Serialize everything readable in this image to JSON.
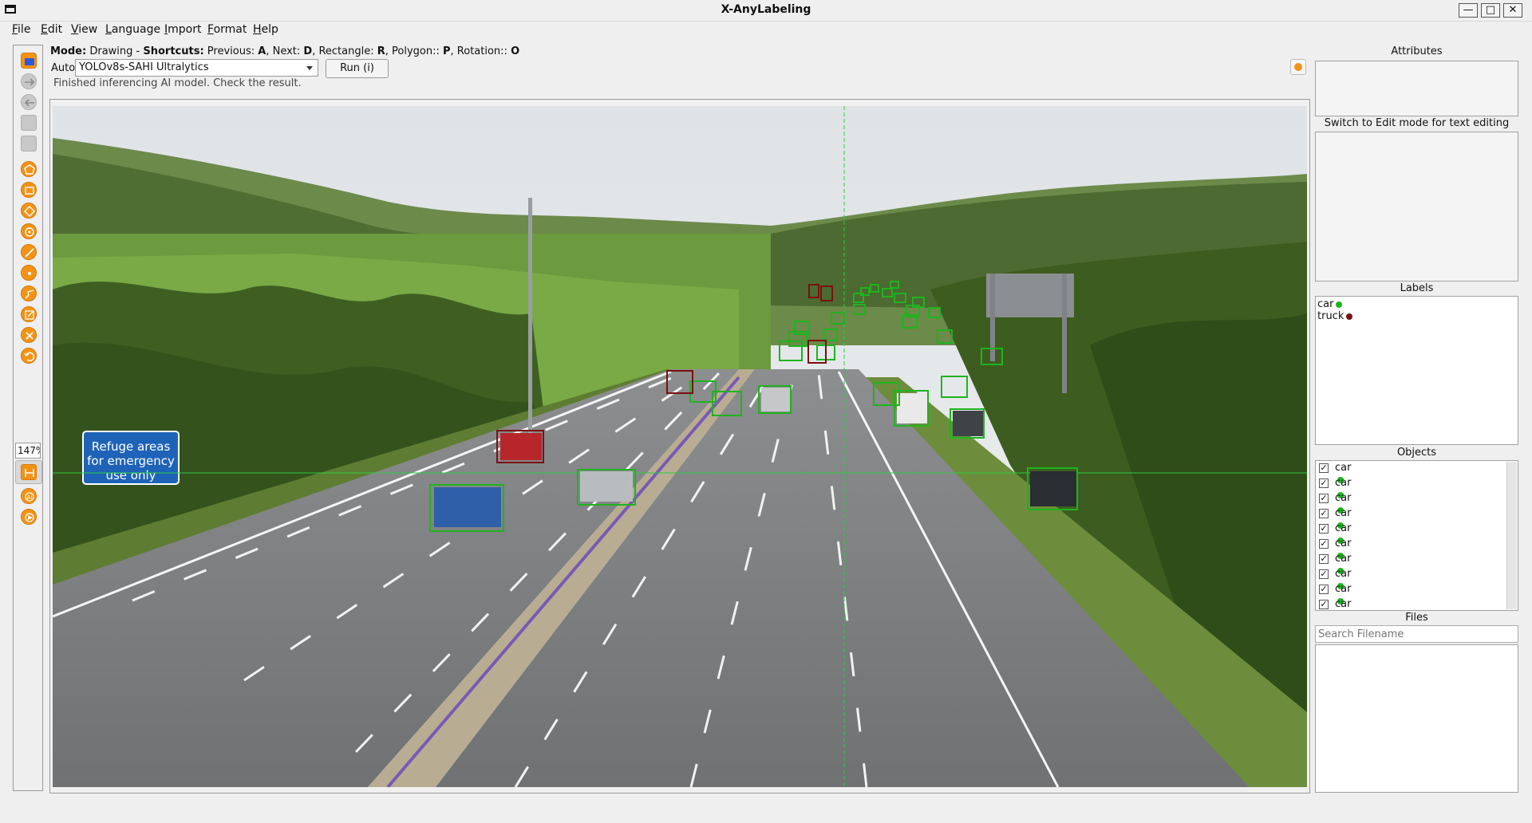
{
  "window": {
    "title": "X-AnyLabeling"
  },
  "menu": [
    "File",
    "Edit",
    "View",
    "Language",
    "Import",
    "Format",
    "Help"
  ],
  "mode_bar": {
    "mode_label": "Mode:",
    "mode_value": "Drawing",
    "sep": " - ",
    "shortcuts_label": "Shortcuts:",
    "previous": " Previous: ",
    "previous_key": "A",
    "next": ", Next: ",
    "next_key": "D",
    "rectangle": ", Rectangle: ",
    "rectangle_key": "R",
    "polygon": ", Polygon:: ",
    "polygon_key": "P",
    "rotation": ", Rotation:: ",
    "rotation_key": "O"
  },
  "auto": {
    "label": "Auto",
    "model": "YOLOv8s-SAHI Ultralytics",
    "run_button": "Run (i)",
    "status": "Finished inferencing AI model. Check the result."
  },
  "toolbar": {
    "zoom": "147%"
  },
  "canvas": {
    "sign_text": [
      "Refuge areas",
      "for emergency",
      "use only"
    ]
  },
  "right_panel": {
    "attributes_title": "Attributes",
    "attributes_hint": "Switch to Edit mode for text editing",
    "labels_title": "Labels",
    "labels": [
      {
        "name": "car",
        "color": "#1fb31f"
      },
      {
        "name": "truck",
        "color": "#7a1010"
      }
    ],
    "objects_title": "Objects",
    "objects": [
      {
        "label": "car",
        "checked": true,
        "color": "#1fb31f"
      },
      {
        "label": "car",
        "checked": true,
        "color": "#1fb31f"
      },
      {
        "label": "car",
        "checked": true,
        "color": "#1fb31f"
      },
      {
        "label": "car",
        "checked": true,
        "color": "#1fb31f"
      },
      {
        "label": "car",
        "checked": true,
        "color": "#1fb31f"
      },
      {
        "label": "car",
        "checked": true,
        "color": "#1fb31f"
      },
      {
        "label": "car",
        "checked": true,
        "color": "#1fb31f"
      },
      {
        "label": "car",
        "checked": true,
        "color": "#1fb31f"
      },
      {
        "label": "car",
        "checked": true,
        "color": "#1fb31f"
      },
      {
        "label": "car",
        "checked": true,
        "color": "#1fb31f"
      }
    ],
    "files_title": "Files",
    "search_placeholder": "Search Filename"
  },
  "colors": {
    "accent_orange": "#f39316",
    "car_box": "#1fb31f",
    "truck_box": "#7a1010"
  }
}
